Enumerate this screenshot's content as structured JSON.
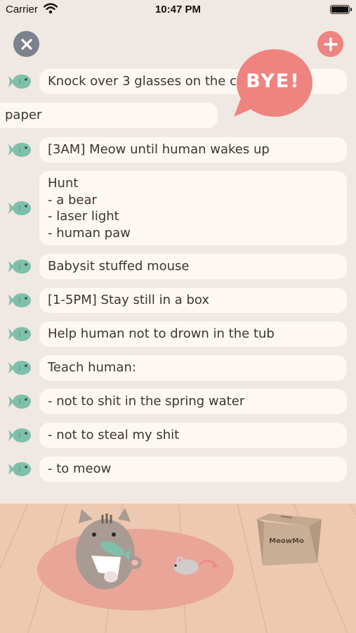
{
  "status_bar": {
    "carrier": "Carrier",
    "time": "10:47 PM",
    "wifi_icon": "wifi-icon",
    "battery_icon": "battery-icon"
  },
  "toolbar": {
    "close_icon": "close-icon",
    "add_icon": "plus-icon",
    "close_color": "#7c818e",
    "add_color": "#ef8380"
  },
  "bye_bubble": {
    "text": "BYE!",
    "color": "#ef8380"
  },
  "dragging_task": {
    "text": "paper"
  },
  "tasks": [
    {
      "icon": "fish-icon",
      "text": "Knock over 3 glasses on the c"
    },
    {
      "icon": "fish-icon",
      "text": "[3AM] Meow until human wakes up"
    },
    {
      "icon": "fish-icon",
      "text": "Hunt\n- a bear\n- laser light\n- human paw"
    },
    {
      "icon": "fish-icon",
      "text": "Babysit stuffed mouse"
    },
    {
      "icon": "fish-icon",
      "text": "[1-5PM] Stay still in a box"
    },
    {
      "icon": "fish-icon",
      "text": "Help human not to drown in the tub"
    },
    {
      "icon": "fish-icon",
      "text": "Teach human:"
    },
    {
      "icon": "fish-icon",
      "text": "- not to shit in the spring water"
    },
    {
      "icon": "fish-icon",
      "text": "- not to steal my shit"
    },
    {
      "icon": "fish-icon",
      "text": "- to meow"
    }
  ],
  "scene": {
    "box_label": "MeowMo",
    "cat_icon": "cat-illustration",
    "mouse_icon": "toy-mouse-illustration",
    "box_icon": "cardboard-box-illustration",
    "floor_color": "#ecc9b0",
    "rug_color": "#e9a597",
    "fish_color": "#7fc0ad"
  }
}
